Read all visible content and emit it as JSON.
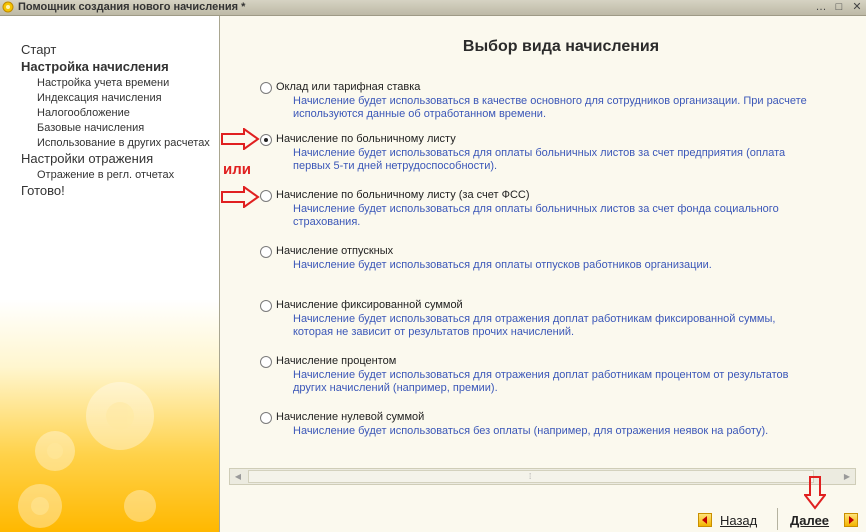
{
  "window": {
    "title": "Помощник создания нового начисления *",
    "buttons": [
      "…",
      "□",
      "✕"
    ]
  },
  "sidebar": {
    "items": [
      {
        "label": "Старт",
        "level": 0,
        "active": false
      },
      {
        "label": "Настройка начисления",
        "level": 0,
        "active": true
      },
      {
        "label": "Настройка учета времени",
        "level": 1
      },
      {
        "label": "Индексация начисления",
        "level": 1
      },
      {
        "label": "Налогообложение",
        "level": 1
      },
      {
        "label": "Базовые начисления",
        "level": 1
      },
      {
        "label": "Использование в других расчетах",
        "level": 1
      },
      {
        "label": "Настройки отражения",
        "level": 0,
        "active": false
      },
      {
        "label": "Отражение в регл. отчетах",
        "level": 1
      },
      {
        "label": "Готово!",
        "level": 0,
        "active": false
      }
    ]
  },
  "main": {
    "title": "Выбор вида начисления",
    "options": [
      {
        "label": "Оклад или тарифная ставка",
        "checked": false,
        "description": "Начисление будет использоваться в качестве основного для сотрудников организации. При расчете используются данные об отработанном времени."
      },
      {
        "label": "Начисление по больничному листу",
        "checked": true,
        "description": "Начисление будет использоваться для оплаты больничных листов за счет предприятия (оплата первых 5-ти дней нетрудоспособности)."
      },
      {
        "label": "Начисление по больничному листу (за счет ФСС)",
        "checked": false,
        "description": "Начисление будет использоваться для оплаты больничных листов за счет фонда социального страхования."
      },
      {
        "label": "Начисление отпускных",
        "checked": false,
        "description": "Начисление будет использоваться для оплаты отпусков работников организации."
      },
      {
        "label": "Начисление фиксированной суммой",
        "checked": false,
        "description": "Начисление будет использоваться для отражения доплат работникам фиксированной суммы, которая не зависит от результатов прочих начислений."
      },
      {
        "label": "Начисление процентом",
        "checked": false,
        "description": "Начисление будет использоваться для отражения доплат работникам процентом от результатов других начислений (например, премии)."
      },
      {
        "label": "Начисление нулевой суммой",
        "checked": false,
        "description": "Начисление будет использоваться без оплаты (например, для отражения неявок на работу)."
      }
    ],
    "annotation_text": "или"
  },
  "footer": {
    "back_label": "Назад",
    "next_label": "Далее"
  },
  "colors": {
    "description_text": "#3b57b8",
    "annotation_red": "#e02020",
    "sidebar_gradient_bottom": "#ffb800"
  }
}
